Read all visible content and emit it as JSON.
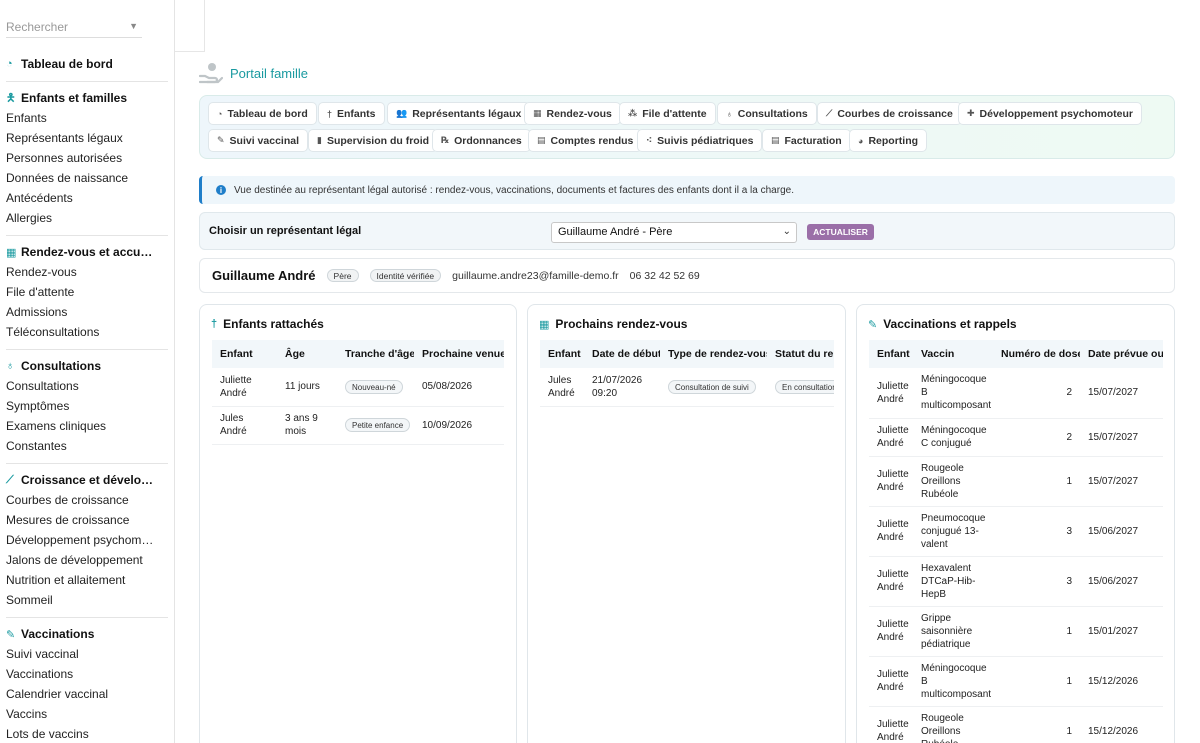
{
  "sidebar": {
    "search_placeholder": "Rechercher",
    "sections": [
      {
        "title": "Tableau de bord",
        "icon": "dashboard-icon",
        "items": []
      },
      {
        "title": "Enfants et familles",
        "icon": "child-icon",
        "items": [
          "Enfants",
          "Représentants légaux",
          "Personnes autorisées",
          "Données de naissance",
          "Antécédents",
          "Allergies"
        ]
      },
      {
        "title": "Rendez-vous et accu…",
        "icon": "calendar-icon",
        "items": [
          "Rendez-vous",
          "File d'attente",
          "Admissions",
          "Téléconsultations"
        ]
      },
      {
        "title": "Consultations",
        "icon": "stethoscope-icon",
        "items": [
          "Consultations",
          "Symptômes",
          "Examens cliniques",
          "Constantes"
        ]
      },
      {
        "title": "Croissance et dévelo…",
        "icon": "chart-line-icon",
        "items": [
          "Courbes de croissance",
          "Mesures de croissance",
          "Développement psychom…",
          "Jalons de développement",
          "Nutrition et allaitement",
          "Sommeil"
        ]
      },
      {
        "title": "Vaccinations",
        "icon": "syringe-icon",
        "items": [
          "Suivi vaccinal",
          "Vaccinations",
          "Calendrier vaccinal",
          "Vaccins",
          "Lots de vaccins"
        ]
      }
    ]
  },
  "portal": {
    "title": "Portail famille"
  },
  "nav_buttons": [
    {
      "label": "Tableau de bord",
      "icon": "dashboard-icon"
    },
    {
      "label": "Enfants",
      "icon": "child-icon"
    },
    {
      "label": "Représentants légaux",
      "icon": "users-icon"
    },
    {
      "label": "Rendez-vous",
      "icon": "calendar-icon"
    },
    {
      "label": "File d'attente",
      "icon": "queue-icon"
    },
    {
      "label": "Consultations",
      "icon": "stethoscope-icon"
    },
    {
      "label": "Courbes de croissance",
      "icon": "chart-line-icon"
    },
    {
      "label": "Développement psychomoteur",
      "icon": "puzzle-icon"
    },
    {
      "label": "Suivi vaccinal",
      "icon": "syringe-icon"
    },
    {
      "label": "Supervision du froid",
      "icon": "thermometer-icon"
    },
    {
      "label": "Ordonnances",
      "icon": "prescription-icon"
    },
    {
      "label": "Comptes rendus",
      "icon": "document-icon"
    },
    {
      "label": "Suivis pédiatriques",
      "icon": "network-icon"
    },
    {
      "label": "Facturation",
      "icon": "invoice-icon"
    },
    {
      "label": "Reporting",
      "icon": "pie-chart-icon"
    }
  ],
  "info": {
    "text": "Vue destinée au représentant légal autorisé : rendez-vous, vaccinations, documents et factures des enfants dont il a la charge."
  },
  "selector": {
    "label": "Choisir un représentant légal",
    "selected": "Guillaume André - Père",
    "button": "ACTUALISER"
  },
  "profile": {
    "name": "Guillaume André",
    "role": "Père",
    "status": "Identité vérifiée",
    "email": "guillaume.andre23@famille-demo.fr",
    "phone": "06 32 42 52 69"
  },
  "children_card": {
    "title": "Enfants rattachés",
    "columns": [
      "Enfant",
      "Âge",
      "Tranche d'âge",
      "Prochaine venue"
    ],
    "rows": [
      {
        "child": "Juliette André",
        "age": "11 jours",
        "range": "Nouveau-né",
        "next": "05/08/2026"
      },
      {
        "child": "Jules André",
        "age": "3 ans 9 mois",
        "range": "Petite enfance",
        "next": "10/09/2026"
      }
    ]
  },
  "appointments_card": {
    "title": "Prochains rendez-vous",
    "columns": [
      "Enfant",
      "Date de début",
      "Type de rendez-vous",
      "Statut du rendez-vous"
    ],
    "rows": [
      {
        "child": "Jules André",
        "date": "21/07/2026 09:20",
        "type": "Consultation de suivi",
        "status": "En consultation"
      }
    ]
  },
  "vaccines_card": {
    "title": "Vaccinations et rappels",
    "columns": [
      "Enfant",
      "Vaccin",
      "Numéro de dose",
      "Date prévue ou administrée"
    ],
    "rows": [
      {
        "child": "Juliette André",
        "vaccine": "Méningocoque B multicomposant",
        "dose": "2",
        "date": "15/07/2027"
      },
      {
        "child": "Juliette André",
        "vaccine": "Méningocoque C conjugué",
        "dose": "2",
        "date": "15/07/2027"
      },
      {
        "child": "Juliette André",
        "vaccine": "Rougeole Oreillons Rubéole",
        "dose": "1",
        "date": "15/07/2027"
      },
      {
        "child": "Juliette André",
        "vaccine": "Pneumocoque conjugué 13-valent",
        "dose": "3",
        "date": "15/06/2027"
      },
      {
        "child": "Juliette André",
        "vaccine": "Hexavalent DTCaP-Hib-HepB",
        "dose": "3",
        "date": "15/06/2027"
      },
      {
        "child": "Juliette André",
        "vaccine": "Grippe saisonnière pédiatrique",
        "dose": "1",
        "date": "15/01/2027"
      },
      {
        "child": "Juliette André",
        "vaccine": "Méningocoque B multicomposant",
        "dose": "1",
        "date": "15/12/2026"
      },
      {
        "child": "Juliette André",
        "vaccine": "Rougeole Oreillons Rubéole",
        "dose": "1",
        "date": "15/12/2026"
      }
    ]
  }
}
